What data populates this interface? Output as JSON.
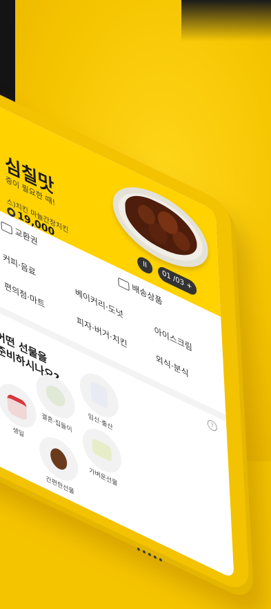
{
  "hero": {
    "title": "심칠맛",
    "subtitle": "증이 필요한 때!",
    "meta": "스)치킨 마늘간장치킨",
    "price": "19,000",
    "price_icon": "coin-icon",
    "pager": "01 /03 +",
    "pause": "II"
  },
  "tabs": {
    "exchange": "교환권",
    "delivery": "배송상품"
  },
  "categories": {
    "coffee": "커피·음료",
    "bakery": "베이커리·도넛",
    "icecream": "아이스크림",
    "convenience": "편의점·마트",
    "pizza": "피자·버거·치킨",
    "dining": "외식·분식"
  },
  "gift": {
    "title_line1": "어떤 선물을",
    "title_line2": "준비하시나요?",
    "help_icon": "question-icon",
    "items": [
      {
        "label": "생일"
      },
      {
        "label": "결혼·집들이"
      },
      {
        "label": "임신·출산"
      },
      {
        "label": "간편한선물"
      },
      {
        "label": "가벼운선물"
      }
    ]
  },
  "colors": {
    "brand": "#f5c400",
    "hero_bg": "#ffd200",
    "dark": "#1a1a1a"
  }
}
